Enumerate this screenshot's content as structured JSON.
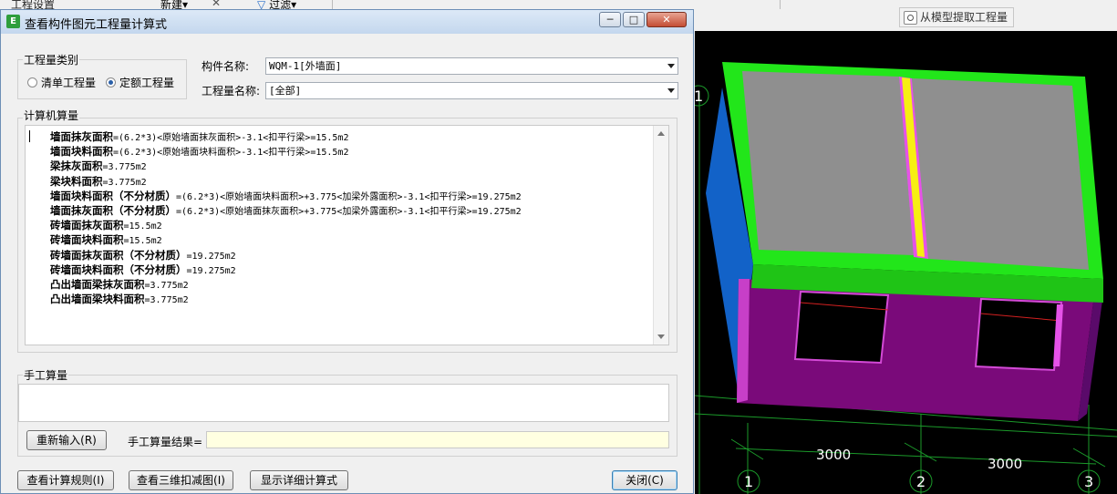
{
  "app": {
    "left_label": "工程设置",
    "toolbar": {
      "new_label": "新建",
      "close_glyph": "✕",
      "filter_label": "过滤"
    },
    "extract_button": "从模型提取工程量"
  },
  "dialog": {
    "title": "查看构件图元工程量计算式",
    "window_buttons": {
      "minimize": "─",
      "maximize": "□",
      "close": "✕"
    },
    "quantity_type": {
      "group_label": "工程量类别",
      "options": [
        {
          "label": "清单工程量",
          "selected": false
        },
        {
          "label": "定额工程量",
          "selected": true
        }
      ]
    },
    "component_name_label": "构件名称:",
    "component_name_value": "WQM-1[外墙面]",
    "quantity_name_label": "工程量名称:",
    "quantity_name_value": "[全部]",
    "computer_calc": {
      "group_label": "计算机算量",
      "lines": [
        {
          "name": "墙面抹灰面积",
          "expr": "=(6.2*3)<原始墙面抹灰面积>-3.1<扣平行梁>=15.5m2"
        },
        {
          "name": "墙面块料面积",
          "expr": "=(6.2*3)<原始墙面块料面积>-3.1<扣平行梁>=15.5m2"
        },
        {
          "name": "梁抹灰面积",
          "expr": "=3.775m2"
        },
        {
          "name": "梁块料面积",
          "expr": "=3.775m2"
        },
        {
          "name": "墙面块料面积（不分材质）",
          "expr": "=(6.2*3)<原始墙面块料面积>+3.775<加梁外露面积>-3.1<扣平行梁>=19.275m2"
        },
        {
          "name": "墙面抹灰面积（不分材质）",
          "expr": "=(6.2*3)<原始墙面抹灰面积>+3.775<加梁外露面积>-3.1<扣平行梁>=19.275m2"
        },
        {
          "name": "砖墙面抹灰面积",
          "expr": "=15.5m2"
        },
        {
          "name": "砖墙面块料面积",
          "expr": "=15.5m2"
        },
        {
          "name": "砖墙面抹灰面积（不分材质）",
          "expr": "=19.275m2"
        },
        {
          "name": "砖墙面块料面积（不分材质）",
          "expr": "=19.275m2"
        },
        {
          "name": "凸出墙面梁抹灰面积",
          "expr": "=3.775m2"
        },
        {
          "name": "凸出墙面梁块料面积",
          "expr": "=3.775m2"
        }
      ]
    },
    "manual_calc": {
      "group_label": "手工算量",
      "reenter_button": "重新输入(R)",
      "result_label": "手工算量结果=",
      "result_value": ""
    },
    "footer": {
      "view_rules": "查看计算规则(I)",
      "view_3d": "查看三维扣减图(I)",
      "show_detail": "显示详细计算式",
      "close": "关闭(C)"
    }
  },
  "viewport": {
    "axis_labels": [
      "1",
      "1",
      "2",
      "3"
    ],
    "dimensions": [
      "3000",
      "3000"
    ]
  }
}
